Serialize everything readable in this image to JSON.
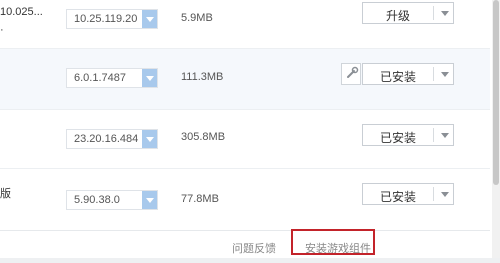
{
  "rows": [
    {
      "name_fragment": "10.025...",
      "name_fragment_2": "",
      "version": "10.25.119.20",
      "size": "5.9MB",
      "action": "升级"
    },
    {
      "name_fragment": "",
      "name_fragment_2": "",
      "version": "6.0.1.7487",
      "size": "111.3MB",
      "action": "已安装"
    },
    {
      "name_fragment": "",
      "name_fragment_2": "",
      "version": "23.20.16.484",
      "size": "305.8MB",
      "action": "已安装"
    },
    {
      "name_fragment": "版",
      "name_fragment_2": "",
      "version": "5.90.38.0",
      "size": "77.8MB",
      "action": "已安装"
    }
  ],
  "footer": {
    "feedback_link": "问题反馈",
    "install_components_link": "安装游戏组件"
  },
  "icons": {
    "version_dropdown": "chevron-down-icon",
    "action_dropdown": "caret-down-icon",
    "settings": "wrench-icon"
  },
  "colors": {
    "dropdown_accent": "#a8c9ec",
    "highlight_row": "#f5f8fc",
    "annotation_box": "#c3232a"
  }
}
